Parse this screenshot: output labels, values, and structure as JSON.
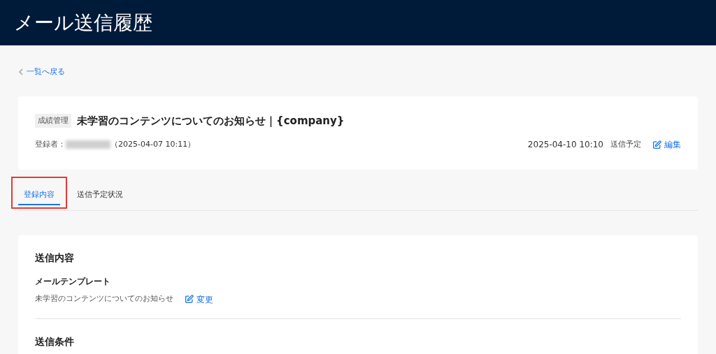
{
  "header": {
    "title": "メール送信履歴"
  },
  "back_link": {
    "label": "一覧へ戻る"
  },
  "summary": {
    "category": "成績管理",
    "title": "未学習のコンテンツについてのお知らせ｜{company}",
    "registrant_label": "登録者：",
    "registrant_name_redacted": true,
    "registered_at": "（2025-04-07 10:11）",
    "send_datetime": "2025-04-10 10:10",
    "status": "送信予定",
    "edit_label": "編集"
  },
  "tabs": [
    {
      "label": "登録内容",
      "selected": true,
      "highlighted": true
    },
    {
      "label": "送信予定状況",
      "selected": false,
      "highlighted": false
    }
  ],
  "content": {
    "sections": [
      {
        "heading": "送信内容",
        "field_label": "メールテンプレート",
        "value": "未学習のコンテンツについてのお知らせ",
        "action_label": "変更"
      },
      {
        "heading": "送信条件"
      }
    ]
  }
}
